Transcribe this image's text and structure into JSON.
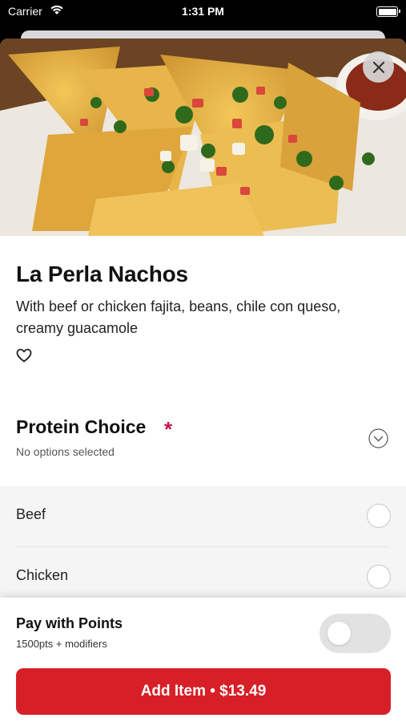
{
  "status_bar": {
    "carrier": "Carrier",
    "time": "1:31 PM",
    "icons": [
      "wifi-icon",
      "battery-icon"
    ]
  },
  "item": {
    "title": "La Perla Nachos",
    "description": "With beef or chicken fajita, beans, chile con queso, creamy guacamole",
    "favorite_icon": "heart-icon",
    "close_icon": "close-icon"
  },
  "protein_choice": {
    "title": "Protein Choice",
    "required_marker": "*",
    "subtitle": "No options selected",
    "expand_icon": "chevron-down-icon",
    "options": [
      {
        "label": "Beef",
        "selected": false
      },
      {
        "label": "Chicken",
        "selected": false
      }
    ]
  },
  "points": {
    "title": "Pay with Points",
    "subtitle": "1500pts + modifiers",
    "enabled": false
  },
  "add_button": {
    "label": "Add Item • $13.49"
  },
  "colors": {
    "accent_red": "#d71f27",
    "required_star": "#c8174a",
    "options_background": "#f5f5f5",
    "toggle_off": "#e2e2e2"
  }
}
